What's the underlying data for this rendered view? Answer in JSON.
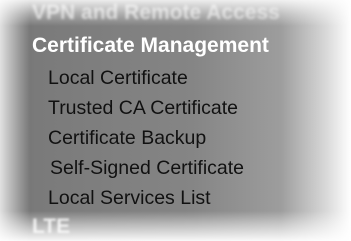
{
  "menu": {
    "previous_section": "VPN and Remote Access",
    "current_section": "Certificate Management",
    "items": [
      {
        "label": "Local Certificate"
      },
      {
        "label": "Trusted CA Certificate"
      },
      {
        "label": "Certificate Backup"
      },
      {
        "label": "Self-Signed Certificate"
      },
      {
        "label": "Local Services List"
      }
    ],
    "next_section": "LTE"
  },
  "colors": {
    "panel_background": "#858585",
    "section_text": "#ffffff",
    "item_text": "#111111"
  }
}
